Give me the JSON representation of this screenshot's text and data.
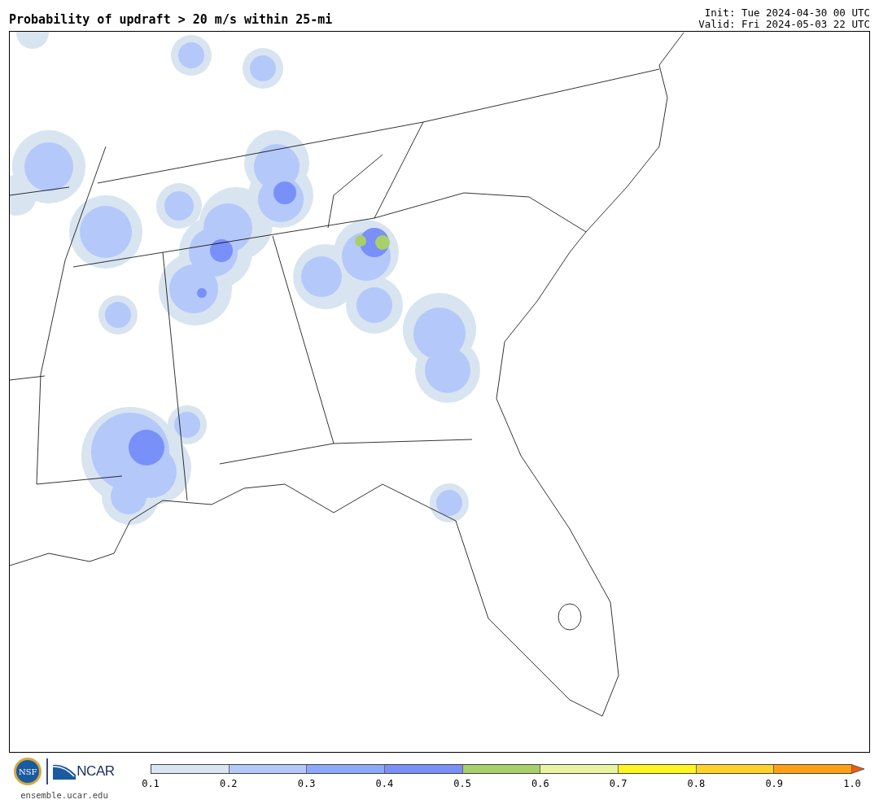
{
  "title": "Probability of updraft > 20 m/s within 25-mi",
  "init": "Init: Tue 2024-04-30 00 UTC",
  "valid": "Valid: Fri 2024-05-03 22 UTC",
  "logos": {
    "nsf": "NSF",
    "ncar": "NCAR"
  },
  "site": "ensemble.ucar.edu",
  "colorbar": {
    "bins": [
      {
        "color": "#d8e4f0"
      },
      {
        "color": "#b4c8fa"
      },
      {
        "color": "#8ca8fa"
      },
      {
        "color": "#7890f8"
      },
      {
        "color": "#a8d068"
      },
      {
        "color": "#e8f4a0"
      },
      {
        "color": "#fff51c"
      },
      {
        "color": "#ffd228"
      },
      {
        "color": "#ffa014"
      }
    ],
    "overflow": {
      "color": "#f05a14"
    },
    "ticks": [
      "0.1",
      "0.2",
      "0.3",
      "0.4",
      "0.5",
      "0.6",
      "0.7",
      "0.8",
      "0.9",
      "1.0"
    ]
  }
}
